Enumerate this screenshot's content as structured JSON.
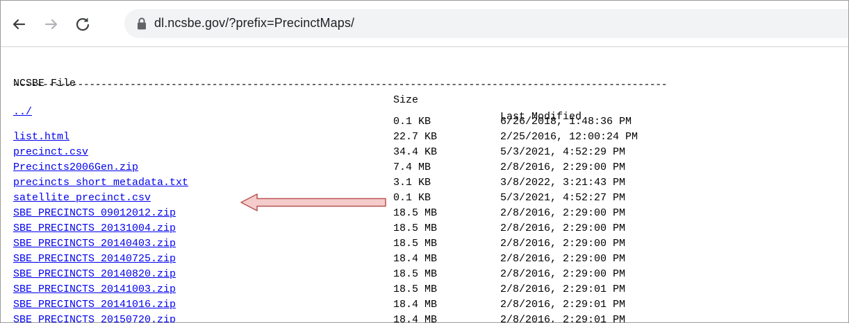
{
  "browser": {
    "url": "dl.ncsbe.gov/?prefix=PrecinctMaps/",
    "icons": [
      "back-arrow-icon",
      "forward-arrow-icon",
      "reload-icon",
      "lock-icon"
    ]
  },
  "listing": {
    "headers": {
      "name": "NCSBE File",
      "size": "Size",
      "modified": "Last Modified"
    },
    "divider": "----------------------------------------------------------------------------------------------------------------",
    "parent_link": "../",
    "rows": [
      {
        "name": "",
        "size": "0.1 KB",
        "modified": "6/26/2018, 1:48:36 PM"
      },
      {
        "name": "list.html",
        "size": "22.7 KB",
        "modified": "2/25/2016, 12:00:24 PM"
      },
      {
        "name": "precinct.csv",
        "size": "34.4 KB",
        "modified": "5/3/2021, 4:52:29 PM"
      },
      {
        "name": "Precincts2006Gen.zip",
        "size": "7.4 MB",
        "modified": "2/8/2016, 2:29:00 PM"
      },
      {
        "name": "precincts_short_metadata.txt",
        "size": "3.1 KB",
        "modified": "3/8/2022, 3:21:43 PM"
      },
      {
        "name": "satellite_precinct.csv",
        "size": "0.1 KB",
        "modified": "5/3/2021, 4:52:27 PM"
      },
      {
        "name": "SBE_PRECINCTS_09012012.zip",
        "size": "18.5 MB",
        "modified": "2/8/2016, 2:29:00 PM"
      },
      {
        "name": "SBE_PRECINCTS_20131004.zip",
        "size": "18.5 MB",
        "modified": "2/8/2016, 2:29:00 PM"
      },
      {
        "name": "SBE_PRECINCTS_20140403.zip",
        "size": "18.5 MB",
        "modified": "2/8/2016, 2:29:00 PM"
      },
      {
        "name": "SBE_PRECINCTS_20140725.zip",
        "size": "18.4 MB",
        "modified": "2/8/2016, 2:29:00 PM"
      },
      {
        "name": "SBE_PRECINCTS_20140820.zip",
        "size": "18.5 MB",
        "modified": "2/8/2016, 2:29:00 PM"
      },
      {
        "name": "SBE_PRECINCTS_20141003.zip",
        "size": "18.5 MB",
        "modified": "2/8/2016, 2:29:01 PM"
      },
      {
        "name": "SBE_PRECINCTS_20141016.zip",
        "size": "18.4 MB",
        "modified": "2/8/2016, 2:29:01 PM"
      },
      {
        "name": "SBE_PRECINCTS_20150720.zip",
        "size": "18.4 MB",
        "modified": "2/8/2016, 2:29:01 PM"
      }
    ]
  },
  "annotation": {
    "arrow_fill": "#f4cccc",
    "arrow_stroke": "#b85450",
    "points_to_row": 6
  },
  "colors": {
    "link": "#0000ee",
    "text": "#000000",
    "omnibox": "#f1f3f4",
    "chrome_icon": "#5f6368"
  }
}
